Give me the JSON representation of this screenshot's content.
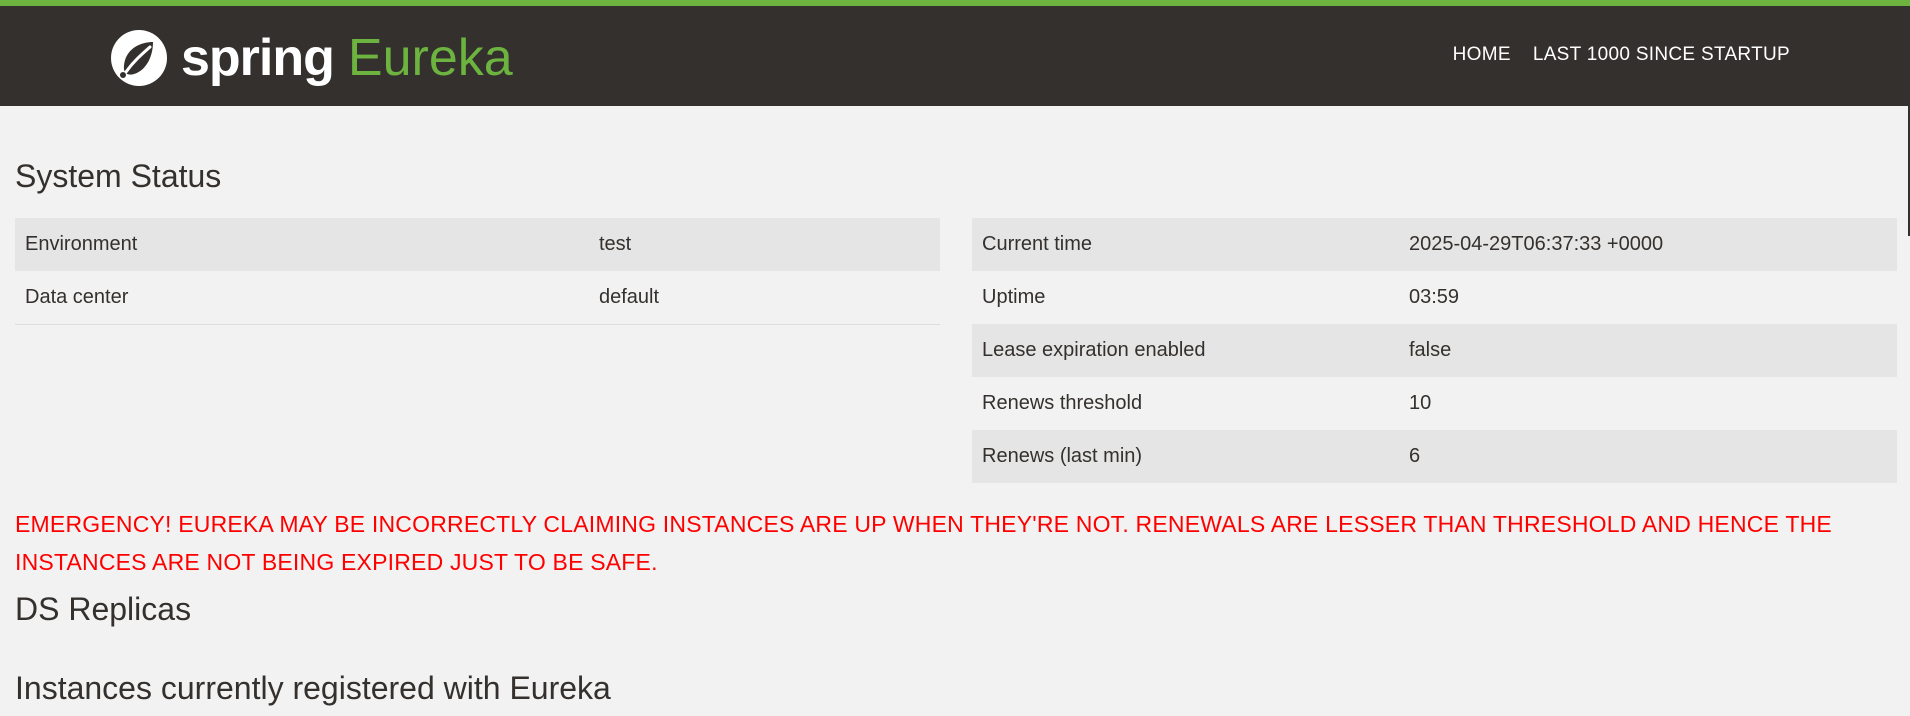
{
  "header": {
    "brand_spring": "spring",
    "brand_eureka": "Eureka",
    "nav": [
      "HOME",
      "LAST 1000 SINCE STARTUP"
    ]
  },
  "colors": {
    "accent": "#6db33f",
    "header_bg": "#34302d",
    "page_bg": "#f2f2f2",
    "emergency": "#ff0000"
  },
  "system_status": {
    "title": "System Status",
    "left_table": [
      {
        "key": "Environment",
        "value": "test"
      },
      {
        "key": "Data center",
        "value": "default"
      }
    ],
    "right_table": [
      {
        "key": "Current time",
        "value": "2025-04-29T06:37:33 +0000"
      },
      {
        "key": "Uptime",
        "value": "03:59"
      },
      {
        "key": "Lease expiration enabled",
        "value": "false"
      },
      {
        "key": "Renews threshold",
        "value": "10"
      },
      {
        "key": "Renews (last min)",
        "value": "6"
      }
    ]
  },
  "emergency_message": "EMERGENCY! EUREKA MAY BE INCORRECTLY CLAIMING INSTANCES ARE UP WHEN THEY'RE NOT. RENEWALS ARE LESSER THAN THRESHOLD AND HENCE THE INSTANCES ARE NOT BEING EXPIRED JUST TO BE SAFE.",
  "ds_replicas": {
    "title": "DS Replicas"
  },
  "instances": {
    "title": "Instances currently registered with Eureka"
  }
}
